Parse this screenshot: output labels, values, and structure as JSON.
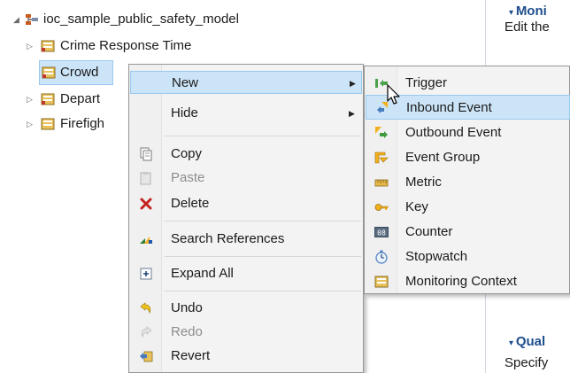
{
  "tree": {
    "root_label": "ioc_sample_public_safety_model",
    "children": [
      {
        "label": "Crime Response Time"
      },
      {
        "label": "Crowd"
      },
      {
        "label": "Depart"
      },
      {
        "label": "Firefigh"
      }
    ]
  },
  "right_pane": {
    "section1_title": "Moni",
    "section1_desc": "Edit the",
    "section2_title": "Qual",
    "section2_desc": "Specify"
  },
  "context_menu": {
    "new": "New",
    "hide": "Hide",
    "copy": "Copy",
    "paste": "Paste",
    "delete": "Delete",
    "search_references": "Search References",
    "expand_all": "Expand All",
    "undo": "Undo",
    "redo": "Redo",
    "revert": "Revert"
  },
  "submenu": {
    "trigger": "Trigger",
    "inbound_event": "Inbound Event",
    "outbound_event": "Outbound Event",
    "event_group": "Event Group",
    "metric": "Metric",
    "key": "Key",
    "counter": "Counter",
    "counter_icon_text": "08",
    "stopwatch": "Stopwatch",
    "monitoring_context": "Monitoring Context"
  },
  "colors": {
    "selection": "#cce4f7",
    "selection_border": "#99c9ef",
    "menu_bg": "#f3f3f3",
    "section_title": "#1f4e8c"
  }
}
